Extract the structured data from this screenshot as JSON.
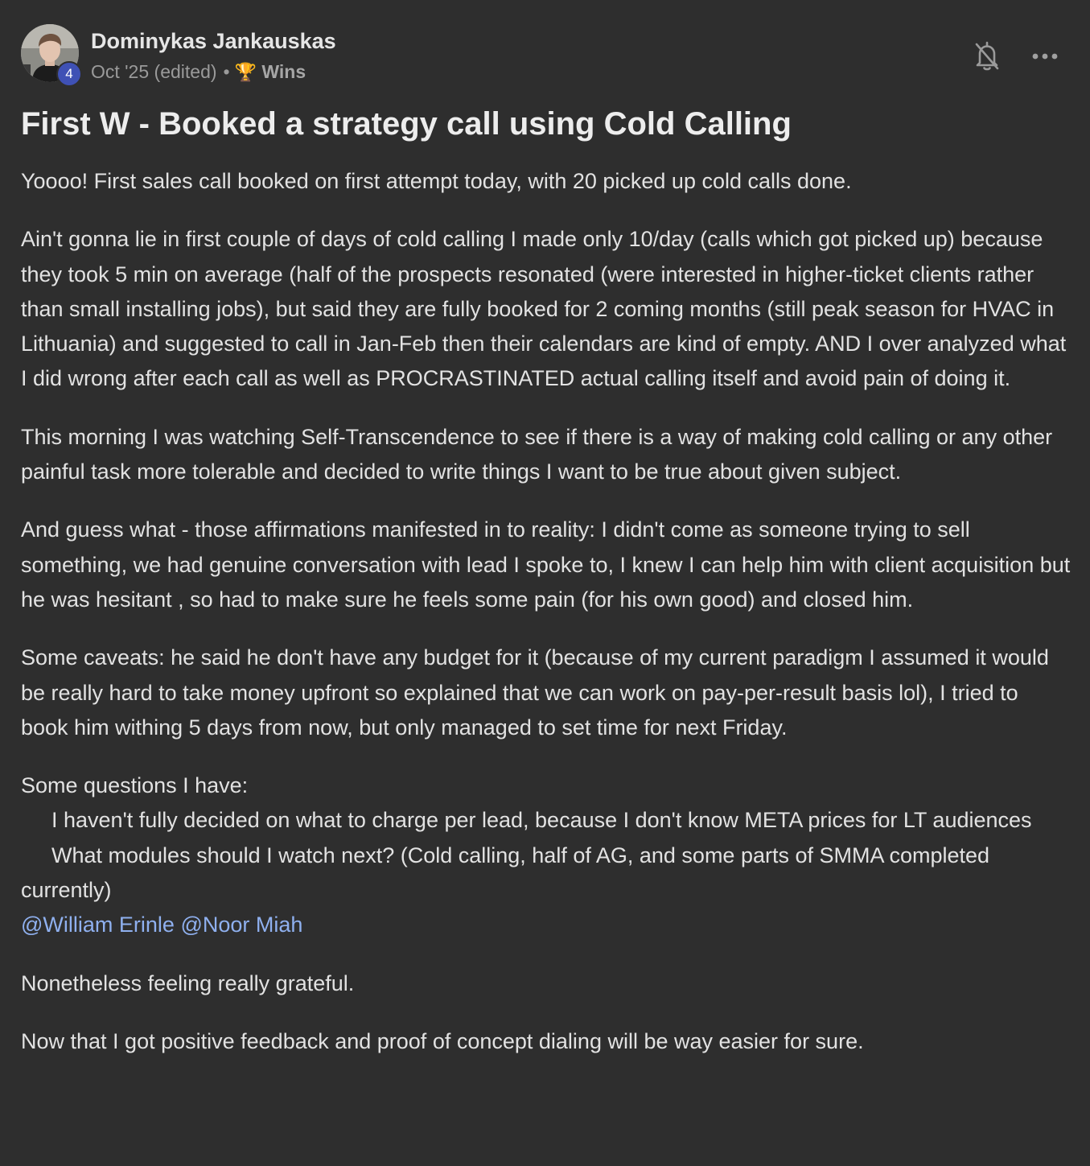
{
  "post": {
    "author": {
      "name": "Dominykas Jankauskas",
      "level": "4"
    },
    "meta": {
      "date": "Oct '25 (edited)",
      "separator": "•",
      "category_icon": "trophy-icon",
      "category_emoji": "🏆",
      "category": "Wins"
    },
    "title": "First W - Booked a strategy call using Cold Calling",
    "paragraphs": [
      "Yoooo! First sales call booked on first attempt today, with 20 picked up cold calls done.",
      "Ain't gonna lie in first couple of days of cold calling I made only 10/day (calls which got picked up) because they took 5 min on average (half of the prospects resonated (were interested in higher-ticket clients rather than small installing jobs), but said they are fully booked for 2 coming months (still peak season for HVAC in Lithuania) and suggested to call in Jan-Feb then their calendars are kind of empty. AND I over analyzed what I did wrong after each call as well as PROCRASTINATED actual calling itself and avoid pain of doing it.",
      "This morning I was watching Self-Transcendence to see if there is a way of making cold calling or any other painful task more tolerable and decided to write things I want to be true about given subject.",
      "And guess what - those affirmations manifested in to reality: I didn't come as someone trying to sell something, we had genuine conversation with lead I spoke to, I knew I can help him with client acquisition but he was hesitant , so had to make sure he feels some pain (for his own good) and closed him.",
      "Some caveats: he said he don't have any budget for it (because of my current paradigm I assumed it would be really hard to take money upfront so explained that we can work on pay-per-result basis lol), I tried to book him withing 5 days from now, but only managed to set time for next Friday."
    ],
    "questions_intro": "Some questions I have:",
    "bullet": "•",
    "questions": [
      "I haven't fully decided on what to charge per lead, because I don't know META prices for LT audiences",
      "What modules should I watch next? (Cold calling, half of AG, and some parts of SMMA completed currently)"
    ],
    "mentions": [
      "@William Erinle",
      "@Noor Miah"
    ],
    "closing": [
      "Nonetheless feeling really grateful.",
      "Now that I got positive feedback and proof of concept dialing will be way easier for sure."
    ]
  },
  "actions": {
    "notify_icon": "bell-off-icon",
    "more_icon": "more-horizontal-icon"
  },
  "colors": {
    "background": "#2e2e2e",
    "text": "#e2e2e2",
    "muted": "#9a9a9a",
    "mention": "#8fb0ef",
    "badge": "#3f51b5"
  }
}
